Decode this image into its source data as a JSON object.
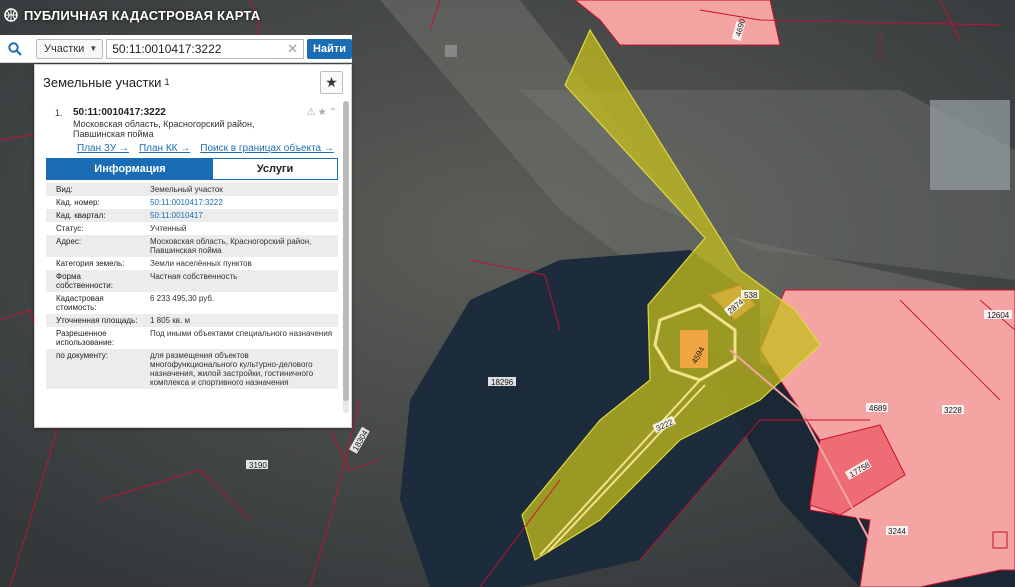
{
  "app": {
    "title": "ПУБЛИЧНАЯ КАДАСТРОВАЯ КАРТА",
    "logo_icon": "globe-icon"
  },
  "search": {
    "type_selected": "Участки",
    "query": "50:11:0010417:3222",
    "find_label": "Найти"
  },
  "panel": {
    "title": "Земельные участки",
    "count": "1",
    "favorites_icon": "star-icon",
    "result": {
      "index": "1.",
      "number": "50:11:0010417:3222",
      "address": "Московская область, Красногорский район, Павшинская пойма",
      "links": [
        "План ЗУ →",
        "План КК →",
        "Поиск в границах объекта →"
      ],
      "tabs": [
        "Информация",
        "Услуги"
      ],
      "attributes": [
        {
          "key": "Вид:",
          "value": "Земельный участок"
        },
        {
          "key": "Кад. номер:",
          "value": "50:11:0010417:3222",
          "link": true
        },
        {
          "key": "Кад. квартал:",
          "value": "50:11:0010417",
          "link": true
        },
        {
          "key": "Статус:",
          "value": "Учтенный"
        },
        {
          "key": "Адрес:",
          "value": "Московская область, Красногорский район, Павшинская пойма"
        },
        {
          "key": "Категория земель:",
          "value": "Земли населённых пунктов"
        },
        {
          "key": "Форма собственности:",
          "value": "Частная собственность"
        },
        {
          "key": "Кадастровая стоимость:",
          "value": "6 233 495,30 руб."
        },
        {
          "key": "Уточненная площадь:",
          "value": "1 805 кв. м"
        },
        {
          "key": "Разрешенное использование:",
          "value": "Под иными объектами специального назначения"
        },
        {
          "key": "по документу:",
          "value": "для размещения объектов многофункционального культурно-делового назначения, жилой застройки, гостиничного комплекса и спортивного назначения"
        }
      ]
    }
  },
  "map": {
    "labels": [
      "4690",
      "538",
      "2874",
      "12604",
      "4689",
      "3228",
      "4594",
      "18296",
      "3222",
      "17758",
      "3244",
      "3190",
      "18304"
    ],
    "colors": {
      "selected_fill": "#c4bd1c",
      "parcel_pink": "#f5a4a4",
      "boundary_red": "#c8102e",
      "accent_blue": "#1a6db5"
    }
  }
}
